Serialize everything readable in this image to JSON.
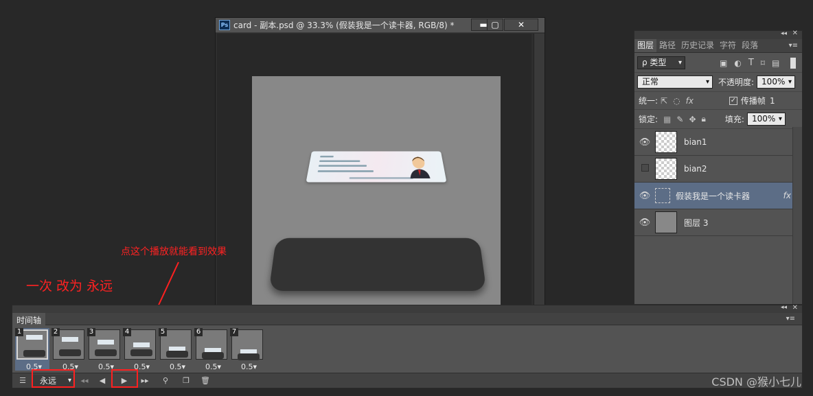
{
  "document": {
    "title": "card - 副本.psd @ 33.3% (假装我是一个读卡器, RGB/8) *",
    "ps_icon": "Ps",
    "min_label": "▬",
    "max_label": "▢",
    "close_label": "✕"
  },
  "annotations": {
    "loop_note": "一次 改为 永远",
    "play_note": "点这个播放就能看到效果",
    "color": "#ff2222"
  },
  "layers_panel": {
    "tabs": [
      "图层",
      "路径",
      "历史记录",
      "字符",
      "段落"
    ],
    "filter_label": "ρ 类型",
    "blend_mode": "正常",
    "opacity_label": "不透明度:",
    "opacity_value": "100%",
    "unify_label": "统一:",
    "propagate_label": "传播帧",
    "propagate_value": "1",
    "lock_label": "锁定:",
    "fill_label": "填充:",
    "fill_value": "100%",
    "layers": [
      {
        "name": "bian1",
        "visible": true,
        "selected": false
      },
      {
        "name": "bian2",
        "visible": false,
        "selected": false
      },
      {
        "name": "假装我是一个读卡器",
        "visible": true,
        "selected": true,
        "fx": "fx"
      },
      {
        "name": "图层 3",
        "visible": true,
        "selected": false
      }
    ]
  },
  "timeline": {
    "title": "时间轴",
    "loop_value": "永远",
    "frames": [
      {
        "num": "1",
        "delay": "0.5▾",
        "selected": true
      },
      {
        "num": "2",
        "delay": "0.5▾",
        "selected": false
      },
      {
        "num": "3",
        "delay": "0.5▾",
        "selected": false
      },
      {
        "num": "4",
        "delay": "0.5▾",
        "selected": false
      },
      {
        "num": "5",
        "delay": "0.5▾",
        "selected": false
      },
      {
        "num": "6",
        "delay": "0.5▾",
        "selected": false
      },
      {
        "num": "7",
        "delay": "0.5▾",
        "selected": false
      }
    ]
  },
  "watermark": "CSDN @猴小七儿"
}
